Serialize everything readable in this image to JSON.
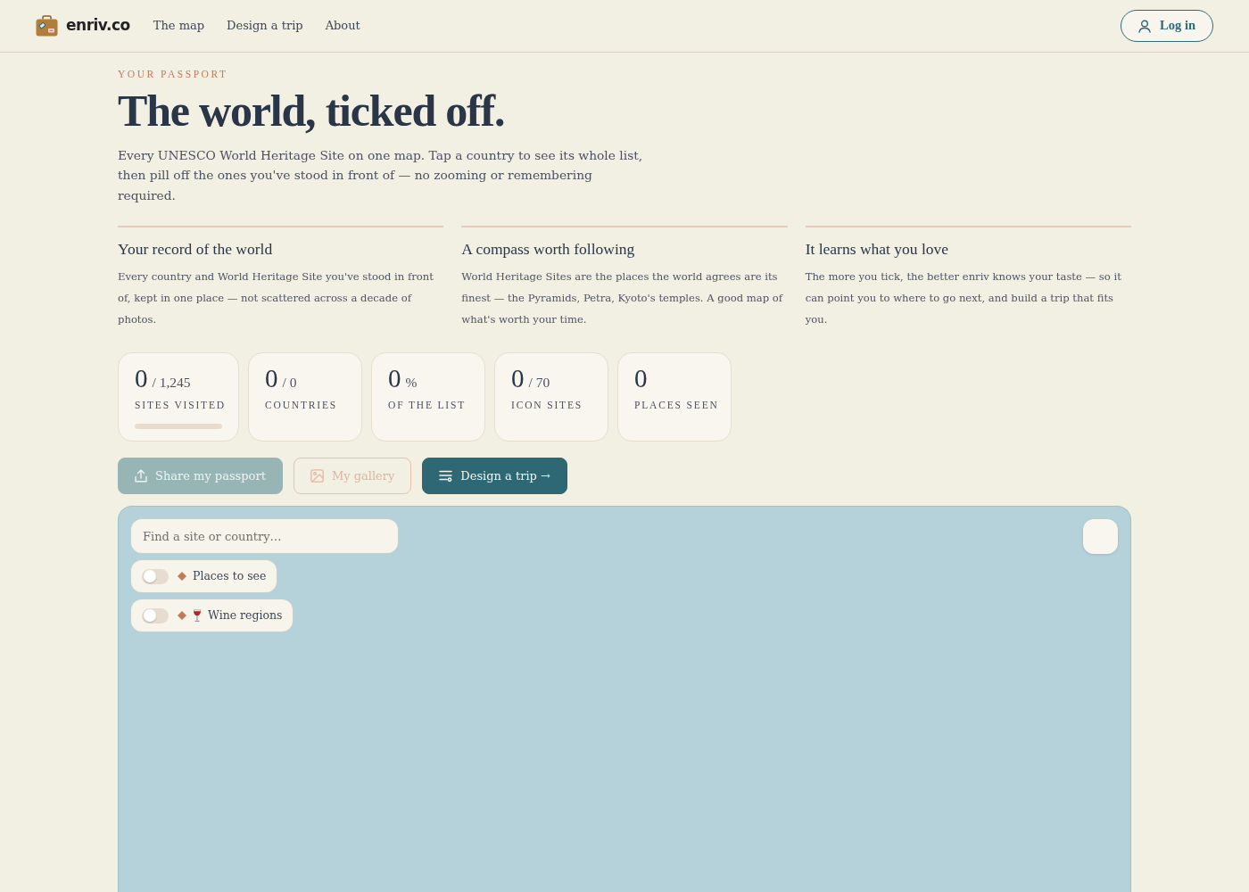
{
  "header": {
    "logo": "enriv.co",
    "nav": [
      {
        "label": "The map"
      },
      {
        "label": "Design a trip"
      },
      {
        "label": "About"
      }
    ],
    "login": "Log in"
  },
  "hero": {
    "eyebrow": "YOUR PASSPORT",
    "title": "The world, ticked off.",
    "intro": "Every UNESCO World Heritage Site on one map. Tap a country to see its whole list, then pill off the ones you've stood in front of — no zooming or remembering required."
  },
  "features": [
    {
      "title": "Your record of the world",
      "body": "Every country and World Heritage Site you've stood in front of, kept in one place — not scattered across a decade of photos."
    },
    {
      "title": "A compass worth following",
      "body": "World Heritage Sites are the places the world agrees are its finest — the Pyramids, Petra, Kyoto's temples. A good map of what's worth your time."
    },
    {
      "title": "It learns what you love",
      "body": "The more you tick, the better enriv knows your taste — so it can point you to where to go next, and build a trip that fits you."
    }
  ],
  "stats": [
    {
      "kind": "progress",
      "value": "0",
      "suffix": "/ 1,245",
      "label": "SITES VISITED",
      "level": 0
    },
    {
      "kind": "count",
      "value": "0",
      "suffix": "/ 0",
      "label": "COUNTRIES"
    },
    {
      "kind": "count",
      "value": "0",
      "suffix": "%",
      "label": "OF THE LIST"
    },
    {
      "kind": "count",
      "value": "0",
      "suffix": "/ 70",
      "label": "ICON SITES"
    },
    {
      "kind": "count",
      "value": "0",
      "label": "PLACES SEEN"
    }
  ],
  "actions": [
    {
      "kind": "share",
      "label": "Share my passport",
      "disabled": true
    },
    {
      "kind": "gallery",
      "label": "My gallery",
      "disabled": true
    },
    {
      "kind": "design",
      "label": "Design a trip →",
      "disabled": false
    }
  ],
  "map": {
    "search": {
      "placeholder": "Find a site or country…"
    },
    "layers": [
      {
        "kind": "plain",
        "label": "Places to see",
        "on": false
      },
      {
        "kind": "glass",
        "label": "Wine regions",
        "on": false
      }
    ]
  }
}
